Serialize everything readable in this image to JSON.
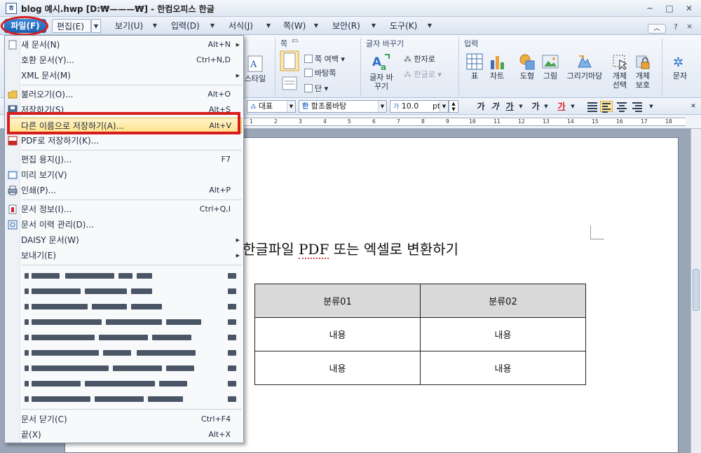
{
  "window": {
    "title": "blog 예시.hwp [D:₩———₩] - 한컴오피스 한글",
    "buttons": {
      "minimize": "─",
      "restore": "□",
      "close": "✕"
    }
  },
  "menubar": {
    "items": [
      {
        "label": "파일(F)"
      },
      {
        "label": "편집(E)"
      },
      {
        "label": "보기(U)"
      },
      {
        "label": "입력(D)"
      },
      {
        "label": "서식(J)"
      },
      {
        "label": "쪽(W)"
      },
      {
        "label": "보안(R)"
      },
      {
        "label": "도구(K)"
      }
    ],
    "right": {
      "help": "?",
      "close": "×",
      "collapse": "︿"
    },
    "highlight_color": "#d81c1c"
  },
  "ribbon": {
    "style_label": "스타일",
    "groups": {
      "page": {
        "title": "쪽",
        "margin": "쪽 여백",
        "background": "바탕쪽",
        "column": "단"
      },
      "conv": {
        "title": "글자 바꾸기",
        "convert": "글자 바꾸기",
        "hanja": "한자로",
        "hangul": "한글로"
      },
      "insert": {
        "title": "입력",
        "table": "표",
        "chart": "차트",
        "shape": "도형",
        "picture": "그림",
        "drawing_mart": "그리기마당",
        "obj_select": "개체 선택",
        "obj_protect": "개체 보호",
        "text": "문자"
      }
    }
  },
  "format_toolbar": {
    "style": "대표",
    "font": "함초롬바탕",
    "font_prefix": "한",
    "size_prefix": "가",
    "size": "10.0",
    "unit": "pt",
    "bold": "가",
    "italic": "가",
    "underline": "가",
    "strike": "가",
    "color_text": "가"
  },
  "ruler": {
    "numbers": [
      "1",
      "2",
      "3",
      "4",
      "5",
      "6",
      "7",
      "8",
      "9",
      "10",
      "11",
      "12",
      "13",
      "14",
      "15",
      "16",
      "17",
      "18"
    ]
  },
  "file_menu": {
    "items": [
      {
        "label": "새 문서(N)",
        "shortcut": "Alt+N",
        "submenu": true
      },
      {
        "label": "호환 문서(Y)...",
        "shortcut": "Ctrl+N,D",
        "submenu": false
      },
      {
        "label": "XML 문서(M)",
        "shortcut": "",
        "submenu": true
      },
      {
        "label": "불러오기(O)...",
        "shortcut": "Alt+O",
        "submenu": false
      },
      {
        "label": "저장하기(S)",
        "shortcut": "Alt+S",
        "submenu": false
      },
      {
        "label": "다른 이름으로 저장하기(A)...",
        "shortcut": "Alt+V",
        "submenu": false
      },
      {
        "label": "PDF로 저장하기(K)...",
        "shortcut": "",
        "submenu": false
      },
      {
        "label": "편집 용지(J)...",
        "shortcut": "F7",
        "submenu": false
      },
      {
        "label": "미리 보기(V)",
        "shortcut": "",
        "submenu": false
      },
      {
        "label": "인쇄(P)...",
        "shortcut": "Alt+P",
        "submenu": false
      },
      {
        "label": "문서 정보(I)...",
        "shortcut": "Ctrl+Q,I",
        "submenu": false
      },
      {
        "label": "문서 이력 관리(D)...",
        "shortcut": "",
        "submenu": false
      },
      {
        "label": "DAISY 문서(W)",
        "shortcut": "",
        "submenu": true
      },
      {
        "label": "보내기(E)",
        "shortcut": "",
        "submenu": true
      },
      {
        "label": "문서 닫기(C)",
        "shortcut": "Ctrl+F4",
        "submenu": false
      },
      {
        "label": "끝(X)",
        "shortcut": "Alt+X",
        "submenu": false
      }
    ],
    "selected_index": 5
  },
  "document": {
    "title_before": "한글파일 ",
    "title_pdf": "PDF",
    "title_after": " 또는 엑셀로 변환하기",
    "table": {
      "headers": [
        "분류01",
        "분류02"
      ],
      "rows": [
        [
          "내용",
          "내용"
        ],
        [
          "내용",
          "내용"
        ]
      ]
    }
  }
}
